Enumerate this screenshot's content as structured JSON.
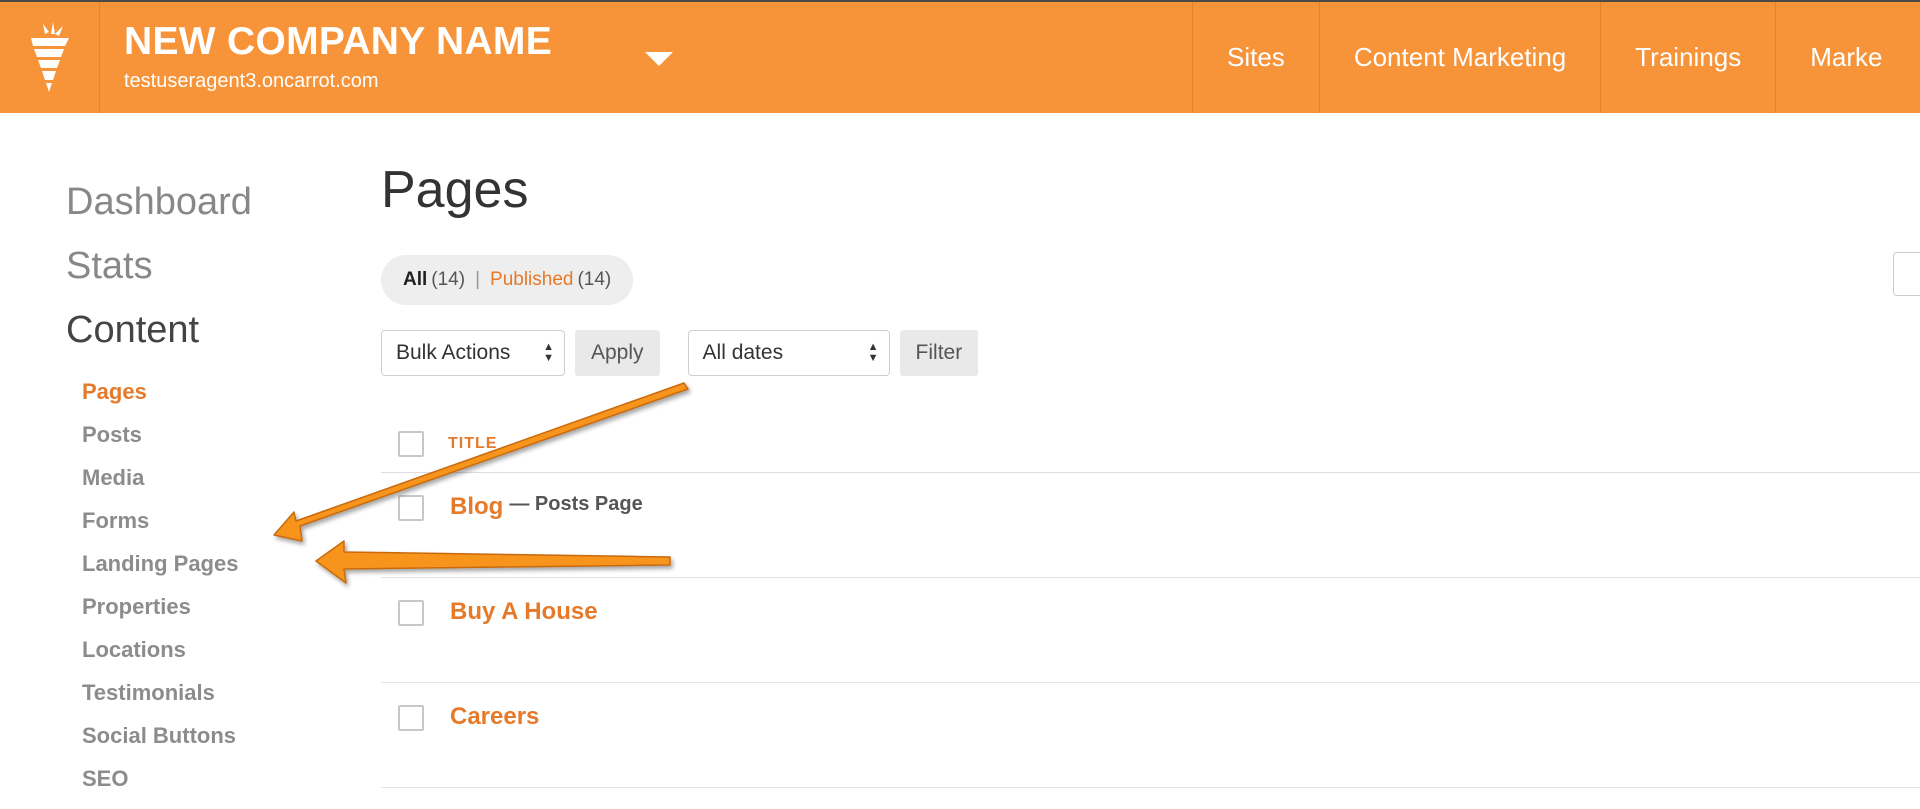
{
  "header": {
    "company_name": "NEW COMPANY NAME",
    "site_url": "testuseragent3.oncarrot.com",
    "nav": [
      "Sites",
      "Content Marketing",
      "Trainings",
      "Marke"
    ]
  },
  "sidebar": {
    "main": [
      "Dashboard",
      "Stats",
      "Content"
    ],
    "sub": [
      "Pages",
      "Posts",
      "Media",
      "Forms",
      "Landing Pages",
      "Properties",
      "Locations",
      "Testimonials",
      "Social Buttons",
      "SEO"
    ],
    "active_sub": "Pages"
  },
  "main": {
    "title": "Pages",
    "filters": {
      "all_label": "All",
      "all_count": "(14)",
      "separator": "|",
      "published_label": "Published",
      "published_count": "(14)"
    },
    "toolbar": {
      "bulk_actions": "Bulk Actions",
      "apply": "Apply",
      "dates": "All dates",
      "filter": "Filter"
    },
    "table": {
      "column_title": "TITLE",
      "rows": [
        {
          "title": "Blog",
          "state": "— Posts Page"
        },
        {
          "title": "Buy A House",
          "state": ""
        },
        {
          "title": "Careers",
          "state": ""
        }
      ]
    }
  },
  "colors": {
    "brand_orange": "#f7943a",
    "link_orange": "#e47a2a",
    "arrow_orange": "#f7941d"
  },
  "icons": [
    "carrot-logo-icon",
    "chevron-down-icon",
    "sort-arrows-icon"
  ]
}
